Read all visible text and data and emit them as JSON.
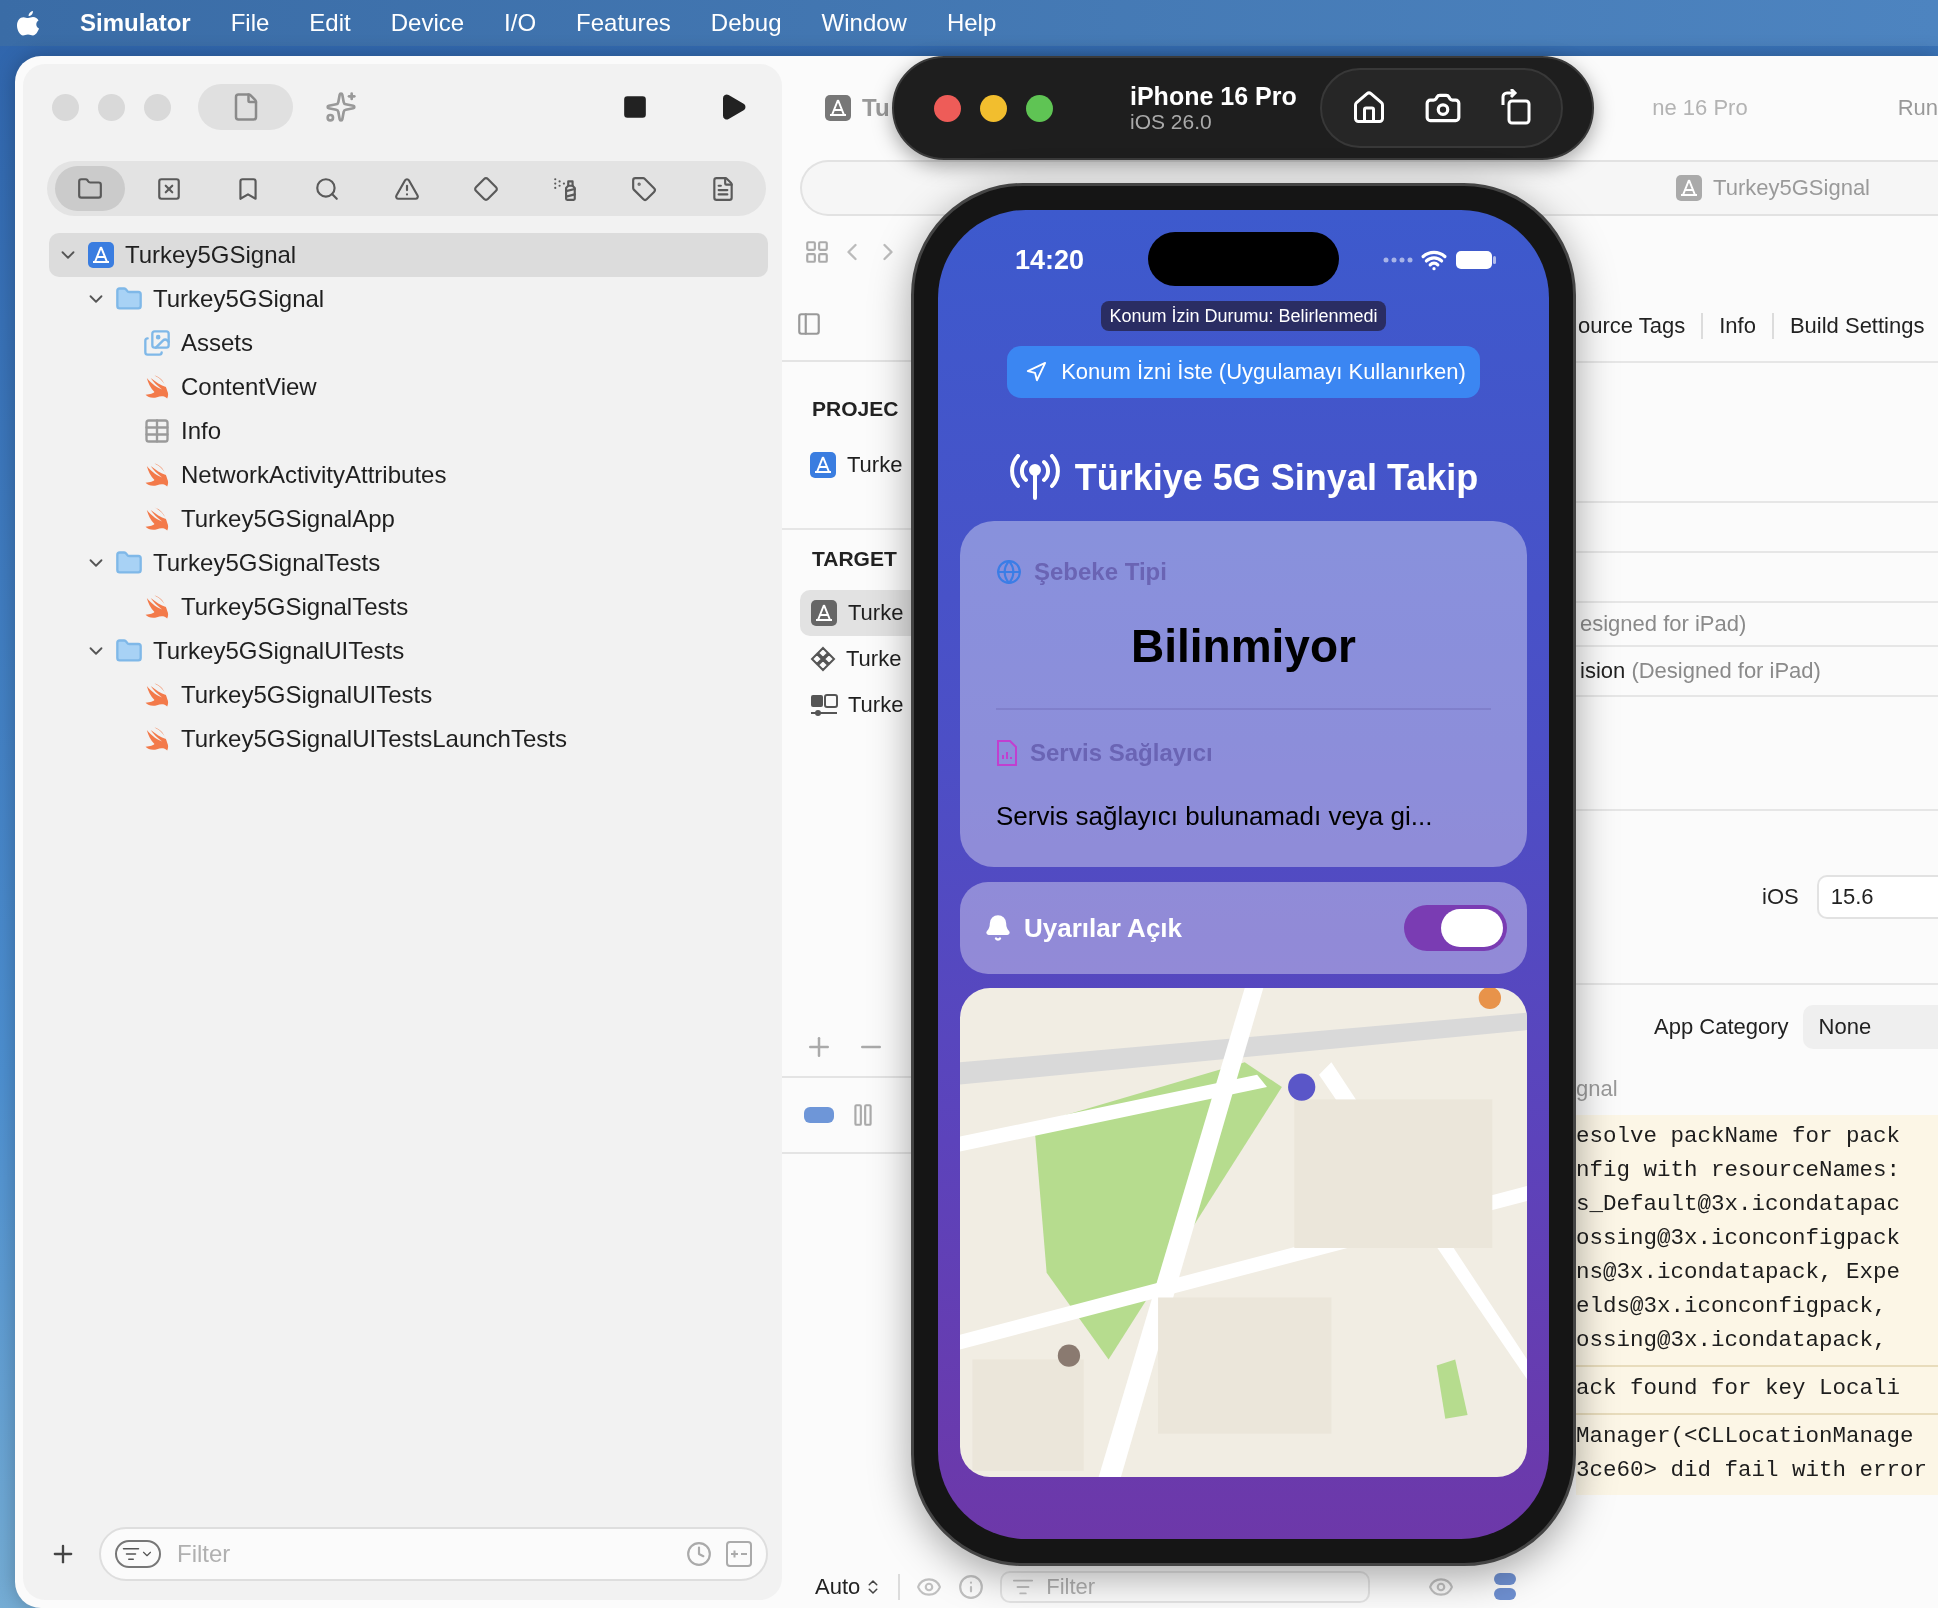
{
  "menu_bar": {
    "app_name": "Simulator",
    "items": [
      "File",
      "Edit",
      "Device",
      "I/O",
      "Features",
      "Debug",
      "Window",
      "Help"
    ]
  },
  "navigator": {
    "tabs": [
      {
        "selected": true
      },
      {
        "selected": false
      },
      {
        "selected": false
      },
      {
        "selected": false
      },
      {
        "selected": false
      },
      {
        "selected": false
      },
      {
        "selected": false
      },
      {
        "selected": false
      },
      {
        "selected": false
      }
    ],
    "tree": [
      {
        "label": "Turkey5GSignal",
        "kind": "project",
        "expanded": true,
        "selected": true,
        "children": [
          {
            "label": "Turkey5GSignal",
            "kind": "folder",
            "expanded": true,
            "selected": false,
            "children": [
              {
                "label": "Assets",
                "kind": "assets",
                "selected": false
              },
              {
                "label": "ContentView",
                "kind": "swift",
                "selected": false
              },
              {
                "label": "Info",
                "kind": "plist",
                "selected": false
              },
              {
                "label": "NetworkActivityAttributes",
                "kind": "swift",
                "selected": false
              },
              {
                "label": "Turkey5GSignalApp",
                "kind": "swift",
                "selected": false
              }
            ]
          },
          {
            "label": "Turkey5GSignalTests",
            "kind": "folder",
            "expanded": true,
            "selected": false,
            "children": [
              {
                "label": "Turkey5GSignalTests",
                "kind": "swift",
                "selected": false
              }
            ]
          },
          {
            "label": "Turkey5GSignalUITests",
            "kind": "folder",
            "expanded": true,
            "selected": false,
            "children": [
              {
                "label": "Turkey5GSignalUITests",
                "kind": "swift",
                "selected": false
              },
              {
                "label": "Turkey5GSignalUITestsLaunchTests",
                "kind": "swift",
                "selected": false
              }
            ]
          }
        ]
      }
    ],
    "filter": {
      "placeholder": "Filter"
    }
  },
  "editor": {
    "title": "Tu",
    "destination": "ne 16 Pro",
    "status": "Run",
    "tab": "Turkey5GSignal",
    "project_header": "PROJEC",
    "projects": [
      {
        "label": "Turke",
        "kind": "project",
        "selected": false
      }
    ],
    "targets_header": "TARGET",
    "targets": [
      {
        "label": "Turke",
        "kind": "app",
        "selected": true
      },
      {
        "label": "Turke",
        "kind": "tests",
        "selected": false
      },
      {
        "label": "Turke",
        "kind": "uitests",
        "selected": false
      }
    ],
    "settings_tabs": [
      "ource Tags",
      "Info",
      "Build Settings"
    ],
    "destinations": [
      {
        "note": "esigned for iPad)"
      },
      {
        "name": "ision",
        "note": "(Designed for iPad)"
      }
    ],
    "deployment": {
      "label": "iOS",
      "value": "15.6"
    },
    "app_category": {
      "label": "App Category",
      "value": "None"
    },
    "faded_label": "gnal",
    "console": [
      [
        "esolve packName for pack",
        "nfig with resourceNames:",
        "s_Default@3x.icondatapac",
        "ossing@3x.iconconfigpack",
        "ns@3x.icondatapack, Expe",
        "elds@3x.iconconfigpack,",
        "ossing@3x.icondatapack,"
      ],
      [
        "ack found for key Locali"
      ],
      [
        "Manager(<CLLocationManage",
        "3ce60> did fail with error"
      ]
    ],
    "bottom_bar": {
      "mode": "Auto",
      "filter_placeholder": "Filter"
    }
  },
  "simulator": {
    "device": "iPhone 16 Pro",
    "os": "iOS 26.0"
  },
  "app": {
    "time": "14:20",
    "permission_badge": "Konum İzin Durumu: Belirlenmedi",
    "request_button": "Konum İzni İste (Uygulamayı Kullanırken)",
    "title": "Türkiye 5G Sinyal Takip",
    "network": {
      "label": "Şebeke Tipi",
      "value": "Bilinmiyor"
    },
    "carrier": {
      "label": "Servis Sağlayıcı",
      "value": "Servis sağlayıcı bulunamadı veya gi..."
    },
    "alerts": {
      "label": "Uyarılar Açık",
      "on": true
    }
  }
}
